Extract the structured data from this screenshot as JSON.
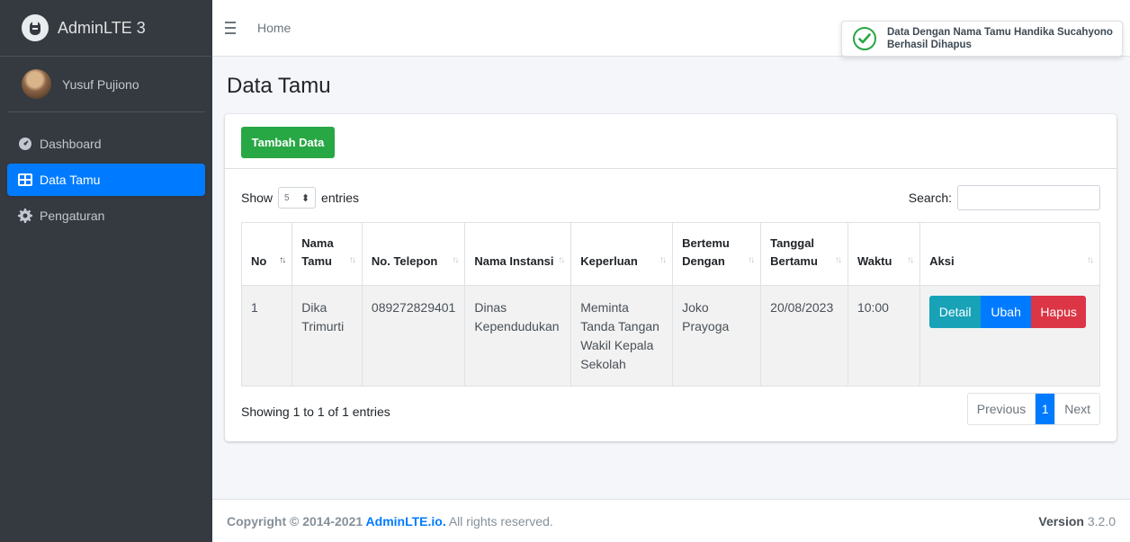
{
  "brand": {
    "name": "AdminLTE 3"
  },
  "user": {
    "name": "Yusuf Pujiono"
  },
  "sidebar": {
    "items": [
      {
        "label": "Dashboard",
        "icon": "tachometer-icon"
      },
      {
        "label": "Data Tamu",
        "icon": "table-icon",
        "active": true
      },
      {
        "label": "Pengaturan",
        "icon": "gear-icon"
      }
    ]
  },
  "topbar": {
    "home": "Home"
  },
  "toast": {
    "message": "Data Dengan Nama Tamu Handika Sucahyono Berhasil Dihapus",
    "icon": "check-circle-icon"
  },
  "page": {
    "title": "Data Tamu"
  },
  "card": {
    "add_button": "Tambah Data",
    "show_label": "Show",
    "entries_label": "entries",
    "page_length": "5",
    "search_label": "Search:",
    "search_value": ""
  },
  "table": {
    "headers": [
      "No",
      "Nama Tamu",
      "No. Telepon",
      "Nama Instansi",
      "Keperluan",
      "Bertemu Dengan",
      "Tanggal Bertamu",
      "Waktu",
      "Aksi"
    ],
    "rows": [
      {
        "no": "1",
        "nama_tamu": "Dika Trimurti",
        "telepon": "089272829401",
        "instansi": "Dinas Kependudukan",
        "keperluan": "Meminta Tanda Tangan Wakil Kepala Sekolah",
        "bertemu": "Joko Prayoga",
        "tanggal": "20/08/2023",
        "waktu": "10:00",
        "actions": {
          "detail": "Detail",
          "ubah": "Ubah",
          "hapus": "Hapus"
        }
      }
    ]
  },
  "table_info": "Showing 1 to 1 of 1 entries",
  "pagination": {
    "previous": "Previous",
    "current": "1",
    "next": "Next"
  },
  "footer": {
    "copyright_prefix": "Copyright © 2014-2021 ",
    "link": "AdminLTE.io.",
    "suffix": " All rights reserved.",
    "version_label": "Version",
    "version": "3.2.0"
  },
  "colors": {
    "primary": "#007bff",
    "success": "#28a745",
    "info": "#17a2b8",
    "danger": "#dc3545",
    "sidebar": "#343a40"
  }
}
